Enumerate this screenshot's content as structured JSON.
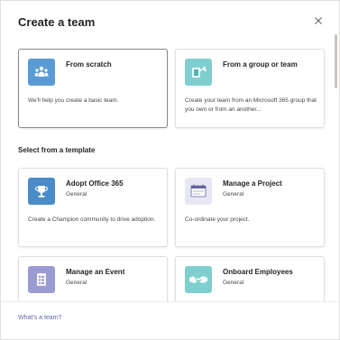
{
  "dialog": {
    "title": "Create a team",
    "close_label": "Close"
  },
  "create_options": [
    {
      "name": "From scratch",
      "description": "We'll help you create a basic team.",
      "icon": "teams-people-icon",
      "color": "#5b9bd5"
    },
    {
      "name": "From a group or team",
      "description": "Create your team from an Microsoft 365 group that you own or from an another...",
      "icon": "group-arrow-icon",
      "color": "#7fcfcf"
    }
  ],
  "templates_section": {
    "label": "Select from a template",
    "templates": [
      {
        "name": "Adopt Office 365",
        "category": "General",
        "description": "Create a Champion community to drive adoption.",
        "icon": "trophy-icon",
        "color": "#4a8cc7"
      },
      {
        "name": "Manage a Project",
        "category": "General",
        "description": "Co-ordinate your project.",
        "icon": "calendar-board-icon",
        "color": "#e8e8f4"
      },
      {
        "name": "Manage an Event",
        "category": "General",
        "description": "",
        "icon": "checklist-icon",
        "color": "#9b9bd4"
      },
      {
        "name": "Onboard Employees",
        "category": "General",
        "description": "",
        "icon": "handshake-icon",
        "color": "#7fcfcf"
      }
    ]
  },
  "footer": {
    "link": "What's a team?"
  }
}
